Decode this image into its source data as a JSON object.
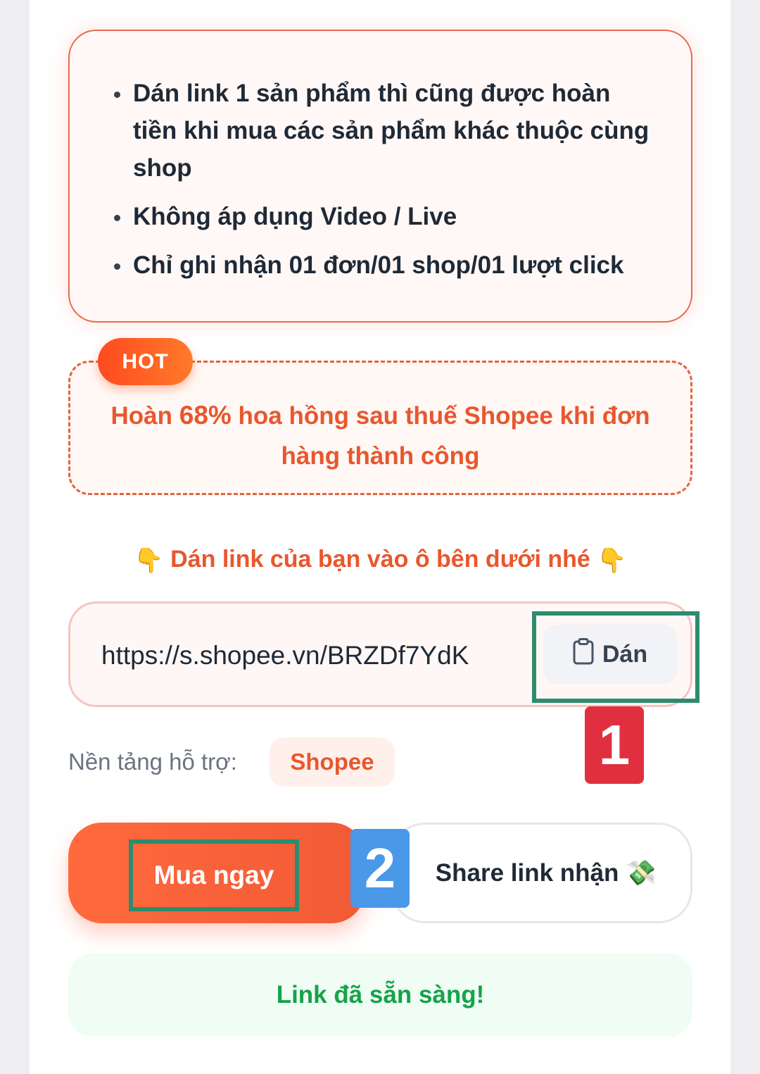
{
  "info": {
    "items": [
      "Dán link 1 sản phẩm thì cũng được hoàn tiền khi mua các sản phẩm khác thuộc cùng shop",
      "Không áp dụng Video / Live",
      "Chỉ ghi nhận 01 đơn/01 shop/01 lượt click"
    ]
  },
  "hot": {
    "badge": "HOT",
    "text_before": "Hoàn ",
    "percent": "68%",
    "text_after": " hoa hồng sau thuế Shopee khi đơn hàng thành công"
  },
  "prompt": {
    "text": " Dán link của bạn vào ô bên dưới nhé ",
    "icon": "👇"
  },
  "input": {
    "value": "https://s.shopee.vn/BRZDf7YdK",
    "paste_label": "Dán",
    "paste_icon": "clipboard-icon"
  },
  "annotations": {
    "step1": "1",
    "step2": "2",
    "frame_color": "#2e8b6e"
  },
  "platform": {
    "label": "Nền tảng hỗ trợ:",
    "chip": "Shopee"
  },
  "actions": {
    "buy_label": "Mua ngay",
    "share_label": "Share link nhận",
    "share_icon": "💸"
  },
  "status": {
    "text": "Link đã sẵn sàng!"
  },
  "colors": {
    "accent": "#e8572e",
    "success": "#16a34a"
  }
}
